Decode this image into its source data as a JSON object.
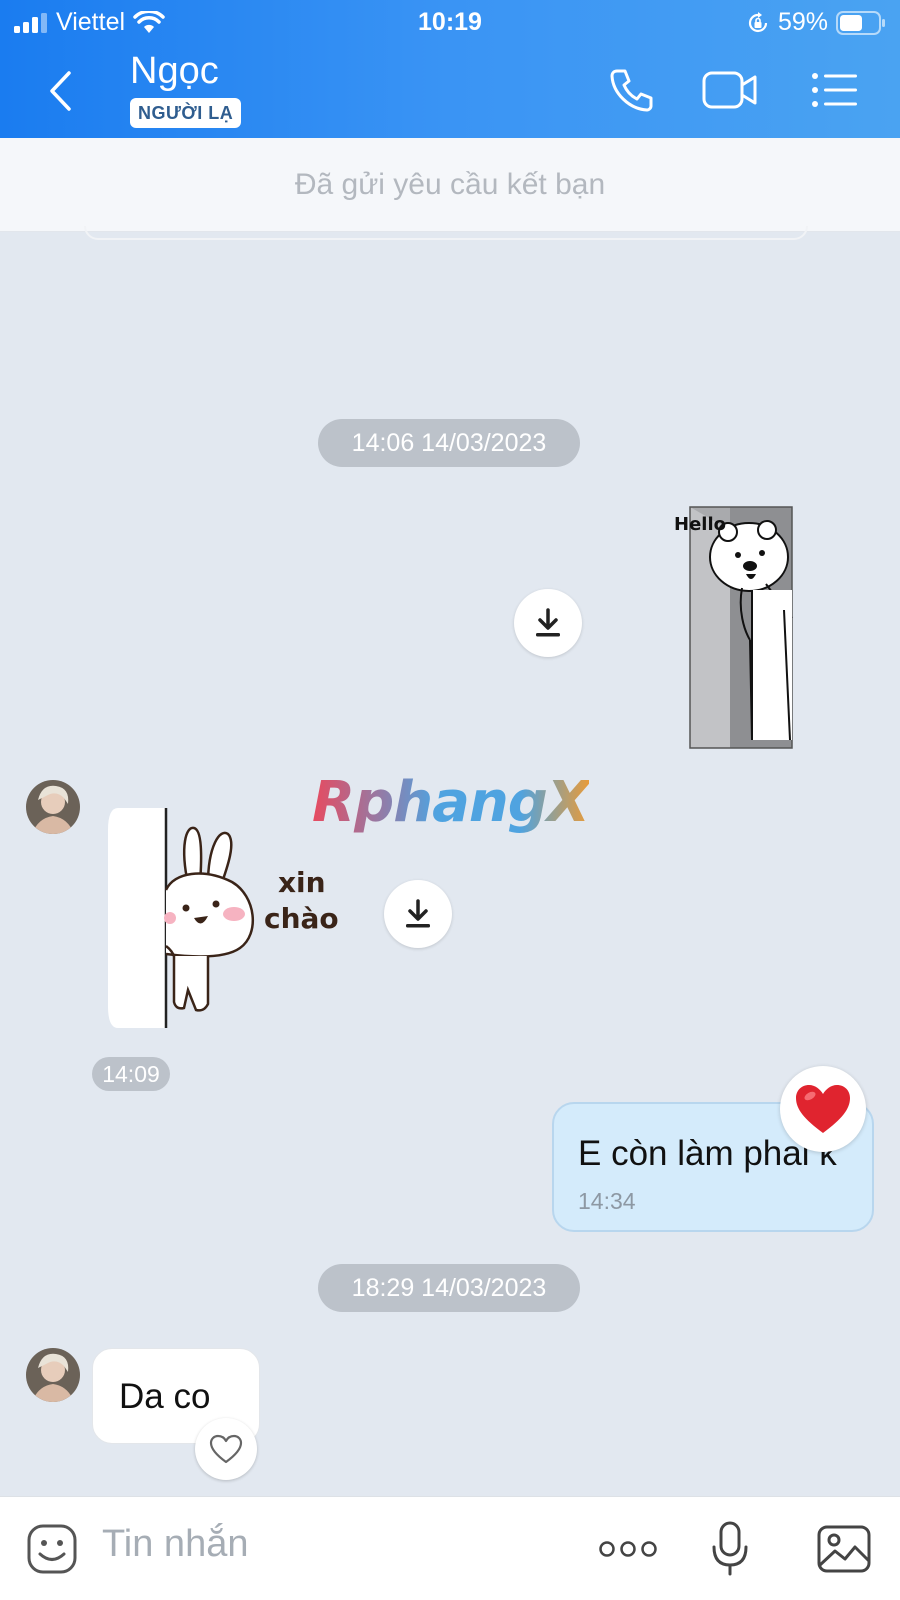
{
  "status_bar": {
    "carrier": "Viettel",
    "time": "10:19",
    "battery": "59%",
    "battery_level": 0.59
  },
  "header": {
    "contact_name": "Ngọc",
    "badge": "NGƯỜI LẠ",
    "icons": [
      "back-icon",
      "phone-icon",
      "video-icon",
      "menu-icon"
    ]
  },
  "friend_request": {
    "status_text": "Đã gửi yêu cầu kết bạn"
  },
  "chat": {
    "separators": [
      "14:06 14/03/2023",
      "18:29 14/03/2023"
    ],
    "sticker_hello_text": "Hello",
    "sticker_xinchao_line1": "xin",
    "sticker_xinchao_line2": "chào",
    "sticker_time": "14:09",
    "watermark": "RphangX",
    "messages": [
      {
        "from": "me",
        "text": "E còn làm phai k",
        "time": "14:34",
        "reaction": "heart"
      },
      {
        "from": "them",
        "text": "Da co"
      }
    ]
  },
  "input_bar": {
    "placeholder": "Tin nhắn"
  },
  "colors": {
    "header_gradient_start": "#1a7cf0",
    "header_gradient_end": "#4aa3f2",
    "chat_background": "#e2e8f0",
    "my_bubble": "#d4ebfb"
  }
}
